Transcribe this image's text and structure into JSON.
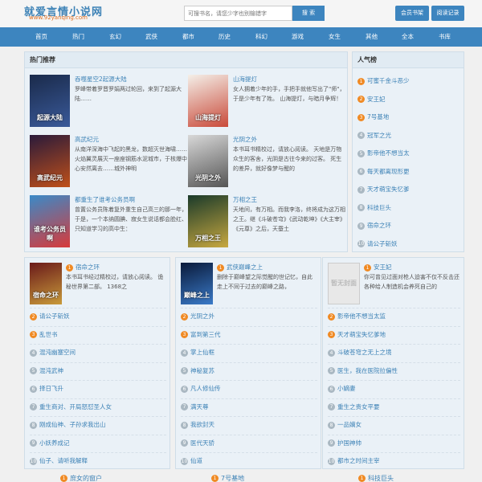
{
  "site": {
    "title": "就爱言情小说网",
    "url": "www.92yanqing.com"
  },
  "search": {
    "placeholder": "可搜书名，请您少字也别输错字",
    "button": "搜 索"
  },
  "header_buttons": [
    "会员书架",
    "阅读记录"
  ],
  "nav": [
    "首页",
    "热门",
    "玄幻",
    "武侠",
    "都市",
    "历史",
    "科幻",
    "游戏",
    "女生",
    "其他",
    "全本",
    "书库"
  ],
  "hot": {
    "title": "热门推荐",
    "items": [
      {
        "title": "吞噬星空2起源大陆",
        "desc": "罗峰带着罗晋罗娟两过轮回，来到了起源大陆……",
        "cover_text": "起源大陆",
        "cover_colors": [
          "#1a2a4a",
          "#3a5a9a"
        ]
      },
      {
        "title": "山海提灯",
        "desc": "女人拥着少年的手，手把手就他写出了\"师\"，于是少年有了姓。 山海提灯，与暗月争辉！",
        "cover_text": "山海提灯",
        "cover_colors": [
          "#f4efe8",
          "#c94a3a"
        ]
      },
      {
        "title": "高武纪元",
        "desc": "从南洋深海中飞起的黑龙，数超灭世海啸……火焰翼灵展灭一座座钢筋水泥城市，于核爆中心安然离去……城外神明",
        "cover_text": "高武纪元",
        "cover_colors": [
          "#2a1a3a",
          "#c0501a"
        ]
      },
      {
        "title": "光阴之外",
        "desc": "本书耳书精校过，请放心阅读。 天地是万物众生的客舍，光阴是古往今来的过客。 死生的差异，就好像梦与醒的",
        "cover_text": "光阴之外",
        "cover_colors": [
          "#d8d8d8",
          "#555"
        ]
      },
      {
        "title": "都重生了谁考公务员啊",
        "desc": "曾置公务员陈着复外重生自己高三的那一年， 于是，一个本纳圆腆、寂女生说话都会脸红、只知道学习的高中生：",
        "cover_text": "谁考公务员啊",
        "cover_colors": [
          "#3a8ac8",
          "#d83a3a"
        ]
      },
      {
        "title": "万相之王",
        "desc": "天地间，有万相。而我李洛，终将成为这万相之王。继《斗破苍穹》《武动乾坤》《大主宰》《元尊》之后，天蚕土",
        "cover_text": "万相之王",
        "cover_colors": [
          "#1a3a2a",
          "#c8a840"
        ]
      }
    ]
  },
  "ranking": {
    "title": "人气榜",
    "items": [
      "可蜜千金斗恶少",
      "安王妃",
      "7号基地",
      "冠军之光",
      "影帝他不想当太",
      "每天都离现形更",
      "天才萌宝失忆爹",
      "科技巨头",
      "宿命之环",
      "请公子斩妖"
    ]
  },
  "columns": [
    {
      "top": {
        "num": "1",
        "title": "宿命之环",
        "desc": "本书耳书经过精校过，请放心阅读。 诡秘世界第二部。 1368之",
        "cover_text": "宿命之环",
        "cover_colors": [
          "#6a1a1a",
          "#c89a3a"
        ]
      },
      "items": [
        "请公子斩妖",
        "乱世书",
        "混沌幽塞空间",
        "混沌武神",
        "择日飞升",
        "重生商对、开局怒怼圣人女",
        "刚成仙神、子孙求我出山",
        "小妖养成记",
        "仙子、请听我解释"
      ]
    },
    {
      "top": {
        "num": "1",
        "title": "武侠巅峰之上",
        "desc": "删除于巅峰望之际觉醒的世记忆，自此走上不同于过去的巅峰之路，",
        "cover_text": "巅峰之上",
        "cover_colors": [
          "#0a1a3a",
          "#3a7ac8"
        ]
      },
      "items": [
        "光阴之外",
        "富到第三代",
        "掌上仙框",
        "神秘复苏",
        "凡人修仙传",
        "满天尊",
        "我欲封天",
        "医代天骄",
        "仙道"
      ]
    },
    {
      "top": {
        "num": "1",
        "title": "安王妃",
        "desc": "你可曾见过面对枪人迫害不仅不反击还各种给人制造机会养死自己的",
        "cover_text": "暂无封面",
        "cover_colors": [
          "#e8e8e8",
          "#e8e8e8"
        ]
      },
      "items": [
        "影帝他不想当太监",
        "天才萌宝失忆爹地",
        "斗破苍穹之无上之境",
        "医生，我在医院拉偏性",
        "小嫡妻",
        "重生之贵女平要",
        "一品嫡女",
        "护国神帅",
        "都市之时间主宰"
      ]
    }
  ],
  "bottom_row": [
    "庶女的窗户",
    "7号基地",
    "科技巨头"
  ]
}
